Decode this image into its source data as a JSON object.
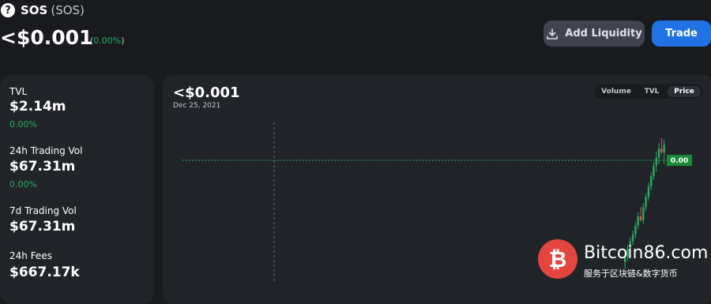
{
  "token": {
    "name": "SOS",
    "symbol": "(SOS)",
    "icon": "question-circle-icon",
    "price": "<$0.001",
    "change": "0.00%"
  },
  "actions": {
    "add_liquidity": "Add Liquidity",
    "trade": "Trade"
  },
  "stats": [
    {
      "label": "TVL",
      "value": "$2.14m",
      "change": "0.00%"
    },
    {
      "label": "24h Trading Vol",
      "value": "$67.31m",
      "change": "0.00%"
    },
    {
      "label": "7d Trading Vol",
      "value": "$67.31m"
    },
    {
      "label": "24h Fees",
      "value": "$667.17k"
    }
  ],
  "chart": {
    "price": "<$0.001",
    "date": "Dec 25, 2021",
    "tabs": [
      "Volume",
      "TVL",
      "Price"
    ],
    "active_tab": "Price",
    "price_tag": "0.00"
  },
  "colors": {
    "accent": "#2172e5",
    "positive": "#27ae60",
    "negative": "#e8505b",
    "card": "#212429",
    "background": "#191b1f"
  },
  "chart_data": {
    "type": "candlestick",
    "title": "",
    "xlabel": "",
    "ylabel": "",
    "current_price_label": "0.00",
    "candles": [
      {
        "o": 0.05,
        "h": 0.12,
        "l": 0.0,
        "c": 0.09
      },
      {
        "o": 0.09,
        "h": 0.18,
        "l": 0.06,
        "c": 0.15
      },
      {
        "o": 0.15,
        "h": 0.24,
        "l": 0.12,
        "c": 0.21
      },
      {
        "o": 0.21,
        "h": 0.29,
        "l": 0.18,
        "c": 0.26
      },
      {
        "o": 0.26,
        "h": 0.36,
        "l": 0.23,
        "c": 0.33
      },
      {
        "o": 0.33,
        "h": 0.43,
        "l": 0.3,
        "c": 0.4
      },
      {
        "o": 0.4,
        "h": 0.47,
        "l": 0.36,
        "c": 0.37
      },
      {
        "o": 0.37,
        "h": 0.5,
        "l": 0.34,
        "c": 0.47
      },
      {
        "o": 0.47,
        "h": 0.58,
        "l": 0.44,
        "c": 0.55
      },
      {
        "o": 0.55,
        "h": 0.66,
        "l": 0.52,
        "c": 0.63
      },
      {
        "o": 0.63,
        "h": 0.74,
        "l": 0.6,
        "c": 0.71
      },
      {
        "o": 0.71,
        "h": 0.82,
        "l": 0.68,
        "c": 0.79
      },
      {
        "o": 0.79,
        "h": 0.9,
        "l": 0.74,
        "c": 0.85
      },
      {
        "o": 0.85,
        "h": 0.96,
        "l": 0.8,
        "c": 0.92
      },
      {
        "o": 0.92,
        "h": 1.0,
        "l": 0.88,
        "c": 0.89
      },
      {
        "o": 0.89,
        "h": 0.99,
        "l": 0.8,
        "c": 0.95
      }
    ]
  },
  "watermark": {
    "name": "Bitcoin86.com",
    "tagline": "服务于区块链&数字货币",
    "symbol": "₿"
  }
}
